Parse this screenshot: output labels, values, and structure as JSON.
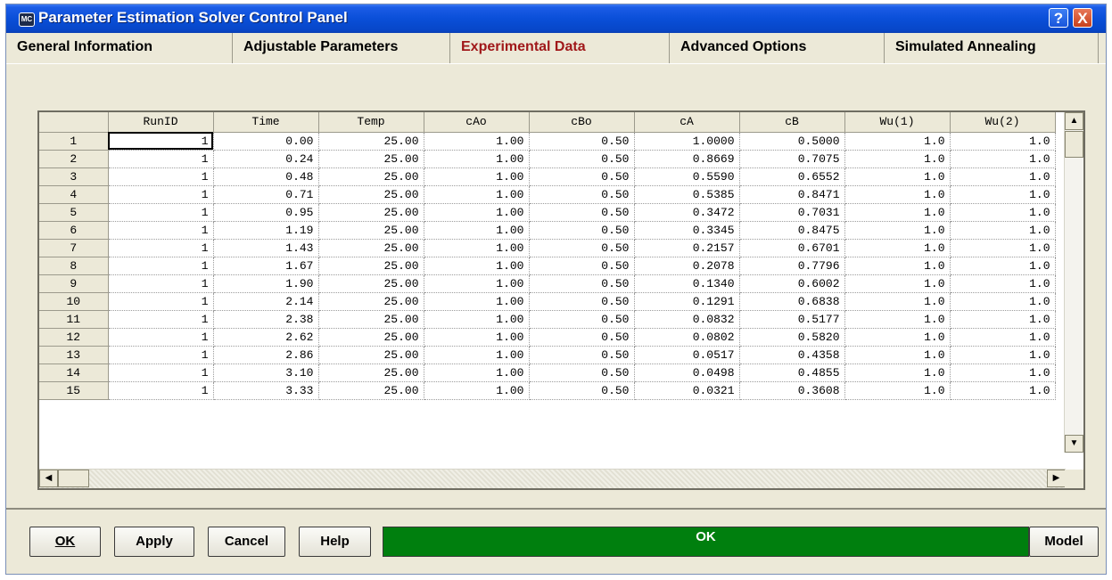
{
  "window": {
    "title": "Parameter Estimation Solver Control Panel",
    "icon_text": "MC"
  },
  "title_buttons": {
    "help": "?",
    "close": "X"
  },
  "tabs": [
    {
      "label": "General Information"
    },
    {
      "label": "Adjustable Parameters"
    },
    {
      "label": "Experimental Data"
    },
    {
      "label": "Advanced Options"
    },
    {
      "label": "Simulated Annealing"
    }
  ],
  "active_tab": "Experimental Data",
  "table": {
    "columns": [
      "RunID",
      "Time",
      "Temp",
      "cAo",
      "cBo",
      "cA",
      "cB",
      "Wu(1)",
      "Wu(2)"
    ],
    "rows": [
      [
        "1",
        "1",
        "0.00",
        "25.00",
        "1.00",
        "0.50",
        "1.0000",
        "0.5000",
        "1.0",
        "1.0"
      ],
      [
        "2",
        "1",
        "0.24",
        "25.00",
        "1.00",
        "0.50",
        "0.8669",
        "0.7075",
        "1.0",
        "1.0"
      ],
      [
        "3",
        "1",
        "0.48",
        "25.00",
        "1.00",
        "0.50",
        "0.5590",
        "0.6552",
        "1.0",
        "1.0"
      ],
      [
        "4",
        "1",
        "0.71",
        "25.00",
        "1.00",
        "0.50",
        "0.5385",
        "0.8471",
        "1.0",
        "1.0"
      ],
      [
        "5",
        "1",
        "0.95",
        "25.00",
        "1.00",
        "0.50",
        "0.3472",
        "0.7031",
        "1.0",
        "1.0"
      ],
      [
        "6",
        "1",
        "1.19",
        "25.00",
        "1.00",
        "0.50",
        "0.3345",
        "0.8475",
        "1.0",
        "1.0"
      ],
      [
        "7",
        "1",
        "1.43",
        "25.00",
        "1.00",
        "0.50",
        "0.2157",
        "0.6701",
        "1.0",
        "1.0"
      ],
      [
        "8",
        "1",
        "1.67",
        "25.00",
        "1.00",
        "0.50",
        "0.2078",
        "0.7796",
        "1.0",
        "1.0"
      ],
      [
        "9",
        "1",
        "1.90",
        "25.00",
        "1.00",
        "0.50",
        "0.1340",
        "0.6002",
        "1.0",
        "1.0"
      ],
      [
        "10",
        "1",
        "2.14",
        "25.00",
        "1.00",
        "0.50",
        "0.1291",
        "0.6838",
        "1.0",
        "1.0"
      ],
      [
        "11",
        "1",
        "2.38",
        "25.00",
        "1.00",
        "0.50",
        "0.0832",
        "0.5177",
        "1.0",
        "1.0"
      ],
      [
        "12",
        "1",
        "2.62",
        "25.00",
        "1.00",
        "0.50",
        "0.0802",
        "0.5820",
        "1.0",
        "1.0"
      ],
      [
        "13",
        "1",
        "2.86",
        "25.00",
        "1.00",
        "0.50",
        "0.0517",
        "0.4358",
        "1.0",
        "1.0"
      ],
      [
        "14",
        "1",
        "3.10",
        "25.00",
        "1.00",
        "0.50",
        "0.0498",
        "0.4855",
        "1.0",
        "1.0"
      ],
      [
        "15",
        "1",
        "3.33",
        "25.00",
        "1.00",
        "0.50",
        "0.0321",
        "0.3608",
        "1.0",
        "1.0"
      ]
    ]
  },
  "buttons": {
    "ok": "OK",
    "apply": "Apply",
    "cancel": "Cancel",
    "help": "Help",
    "model": "Model"
  },
  "status": {
    "text": "OK",
    "color": "#007f0e"
  },
  "colors": {
    "title_bar": "#0a4fd8",
    "active_tab_text": "#a0181a",
    "dialog_bg": "#ece9d8"
  }
}
